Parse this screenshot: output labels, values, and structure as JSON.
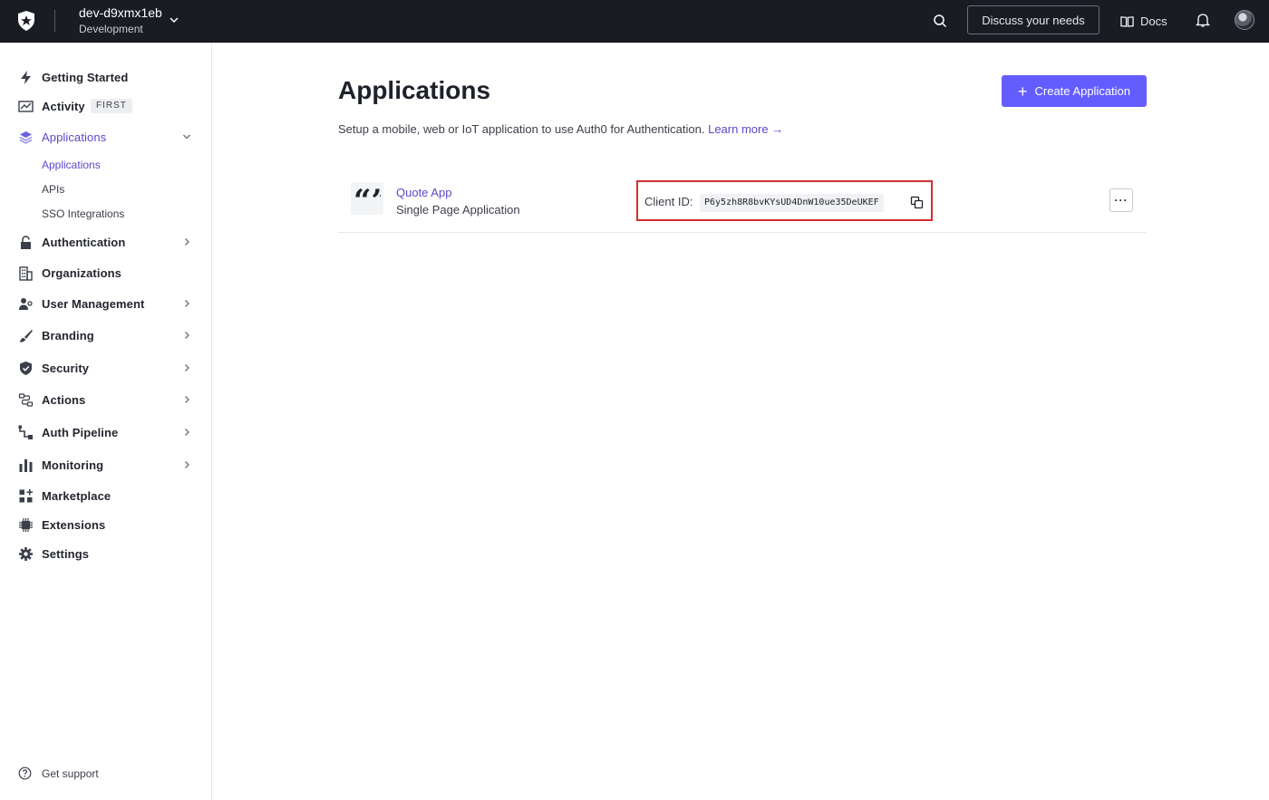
{
  "topbar": {
    "tenant_name": "dev-d9xmx1eb",
    "tenant_env": "Development",
    "discuss_label": "Discuss your needs",
    "docs_label": "Docs"
  },
  "sidebar": {
    "items": [
      {
        "label": "Getting Started",
        "icon": "lightning-icon"
      },
      {
        "label": "Activity",
        "icon": "chart-trend-icon",
        "badge": "FIRST"
      },
      {
        "label": "Applications",
        "icon": "layers-icon",
        "active": true,
        "expanded": true
      },
      {
        "label": "Authentication",
        "icon": "lock-icon"
      },
      {
        "label": "Organizations",
        "icon": "building-icon"
      },
      {
        "label": "User Management",
        "icon": "users-icon"
      },
      {
        "label": "Branding",
        "icon": "brush-icon"
      },
      {
        "label": "Security",
        "icon": "shield-icon"
      },
      {
        "label": "Actions",
        "icon": "flow-icon"
      },
      {
        "label": "Auth Pipeline",
        "icon": "pipeline-icon"
      },
      {
        "label": "Monitoring",
        "icon": "bar-chart-icon"
      },
      {
        "label": "Marketplace",
        "icon": "grid-plus-icon"
      },
      {
        "label": "Extensions",
        "icon": "chip-icon"
      },
      {
        "label": "Settings",
        "icon": "gear-icon"
      }
    ],
    "sub_items": [
      {
        "label": "Applications",
        "active": true
      },
      {
        "label": "APIs"
      },
      {
        "label": "SSO Integrations"
      }
    ],
    "support_label": "Get support"
  },
  "main": {
    "title": "Applications",
    "description": "Setup a mobile, web or IoT application to use Auth0 for Authentication.",
    "learn_more": "Learn more",
    "create_label": "Create Application"
  },
  "apps": [
    {
      "name": "Quote App",
      "type": "Single Page Application",
      "client_label": "Client ID:",
      "client_id": "P6y5zh8R8bvKYsUD4DnW10ue35DeUKEF"
    }
  ],
  "colors": {
    "accent": "#635dff",
    "link": "#5a49c9",
    "topbar": "#1a1c24",
    "highlight": "#d32f2f"
  }
}
